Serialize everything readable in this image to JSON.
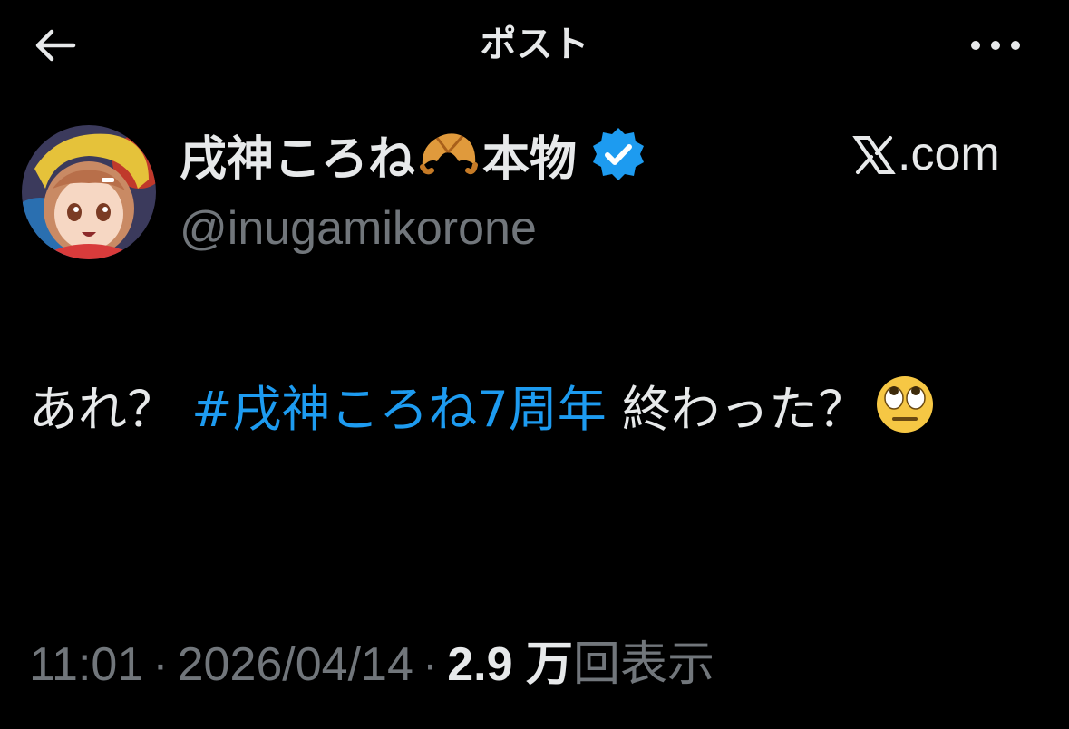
{
  "header": {
    "title": "ポスト",
    "back_icon": "arrow-left-icon",
    "more_icon": "more-dots-icon"
  },
  "author": {
    "display_name_prefix": "戌神ころね",
    "display_name_emoji": "croissant-emoji",
    "display_name_suffix": "本物",
    "verified_icon": "verified-badge-icon",
    "handle": "@inugamikorone"
  },
  "source": {
    "logo_icon": "x-logo-icon",
    "label": ".com"
  },
  "tweet": {
    "text_before": "あれ？",
    "hashtag": "#戌神ころね7周年",
    "text_after": "終わった？",
    "trailing_emoji": "rolling-eyes-emoji"
  },
  "meta": {
    "time": "11:01",
    "date": "2026/04/14",
    "view_count": "2.9 万",
    "view_label": "回表示",
    "separator": "·"
  },
  "colors": {
    "background": "#000000",
    "text_primary": "#e7e9ea",
    "text_secondary": "#71767b",
    "link": "#1d9bf0",
    "verified": "#1d9bf0"
  }
}
